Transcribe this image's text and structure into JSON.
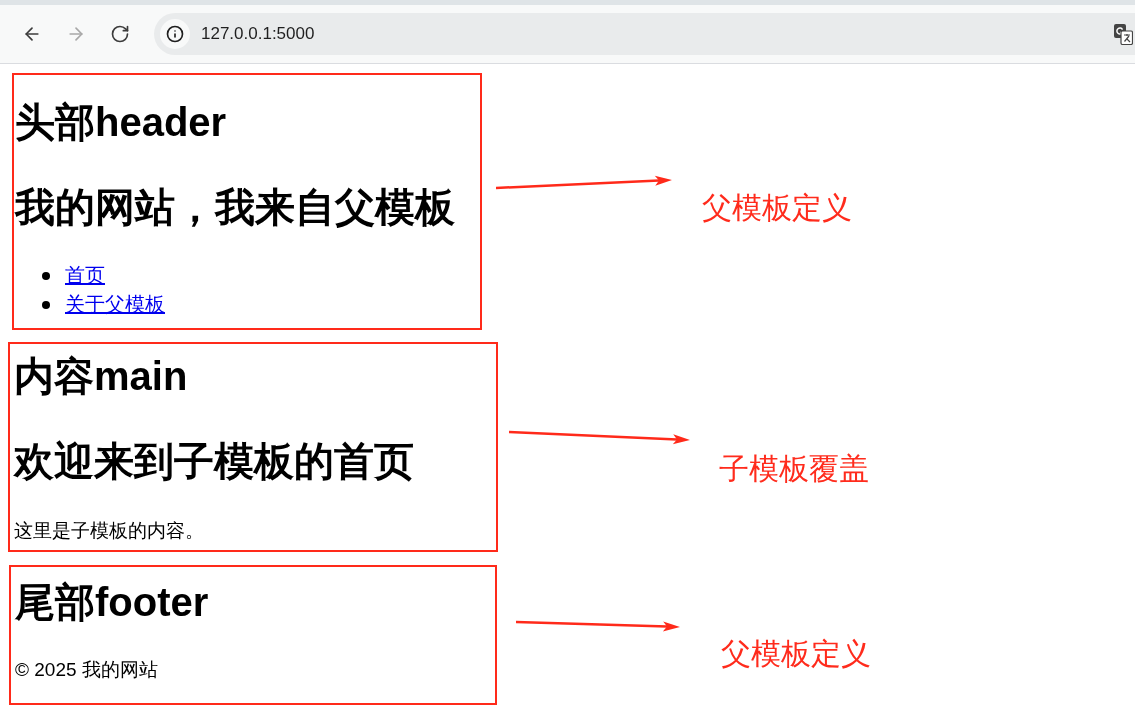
{
  "browser": {
    "nav_buttons": [
      {
        "kind": "back",
        "disabled": false
      },
      {
        "kind": "forward",
        "disabled": true
      },
      {
        "kind": "reload",
        "disabled": false
      }
    ],
    "url": "127.0.0.1:5000"
  },
  "sections": [
    {
      "heading": "头部header",
      "subheading": "我的网站，我来自父模板",
      "links": [
        "首页",
        "关于父模板"
      ],
      "annotation": "父模板定义"
    },
    {
      "heading": "内容main",
      "subheading": "欢迎来到子模板的首页",
      "paragraph": "这里是子模板的内容。",
      "annotation": "子模板覆盖"
    },
    {
      "heading": "尾部footer",
      "paragraph": "© 2025 我的网站",
      "annotation": "父模板定义"
    }
  ]
}
